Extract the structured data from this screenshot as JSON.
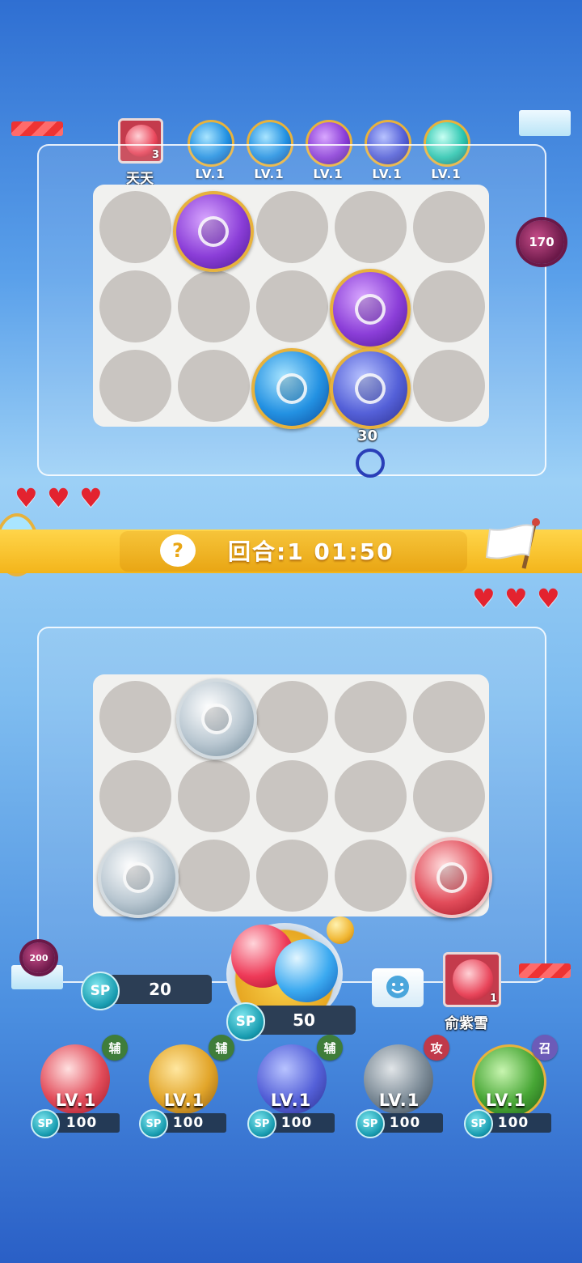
{
  "opponent": {
    "name": "天天",
    "card_count": "3",
    "team": [
      {
        "icon": "vortex-orb-icon",
        "level": "LV.1"
      },
      {
        "icon": "wave-orb-icon",
        "level": "LV.1"
      },
      {
        "icon": "leaf-orb-icon",
        "level": "LV.1"
      },
      {
        "icon": "moon-orb-icon",
        "level": "LV.1"
      },
      {
        "icon": "tornado-orb-icon",
        "level": "LV.1"
      }
    ],
    "monster_hp": "170",
    "damage_text": "30",
    "lives": 3
  },
  "round_bar": {
    "text": "回合:1  01:50",
    "hint_icon": "question-mark-icon",
    "flag_icon": "surrender-flag-icon"
  },
  "player": {
    "name": "俞紫雪",
    "card_count": "1",
    "monster_hp": "200",
    "lives": 3,
    "sp_current": "20",
    "summon_cost": "50",
    "sp_label": "SP",
    "skills": [
      {
        "icon": "fang-orb-icon",
        "level": "LV.1",
        "cost": "100",
        "tag": "辅"
      },
      {
        "icon": "gold-orb-icon",
        "level": "LV.1",
        "cost": "100",
        "tag": "辅"
      },
      {
        "icon": "arrow-orb-icon",
        "level": "LV.1",
        "cost": "100",
        "tag": "辅"
      },
      {
        "icon": "wind-orb-icon",
        "level": "LV.1",
        "cost": "100",
        "tag": "攻"
      },
      {
        "icon": "turtle-orb-icon",
        "level": "LV.1",
        "cost": "100",
        "tag": "召"
      }
    ]
  },
  "colors": {
    "tag_support": "#3f7d3a",
    "tag_attack": "#c0394a",
    "tag_summon": "#6c5bb8",
    "banner": "#f6c43a"
  }
}
